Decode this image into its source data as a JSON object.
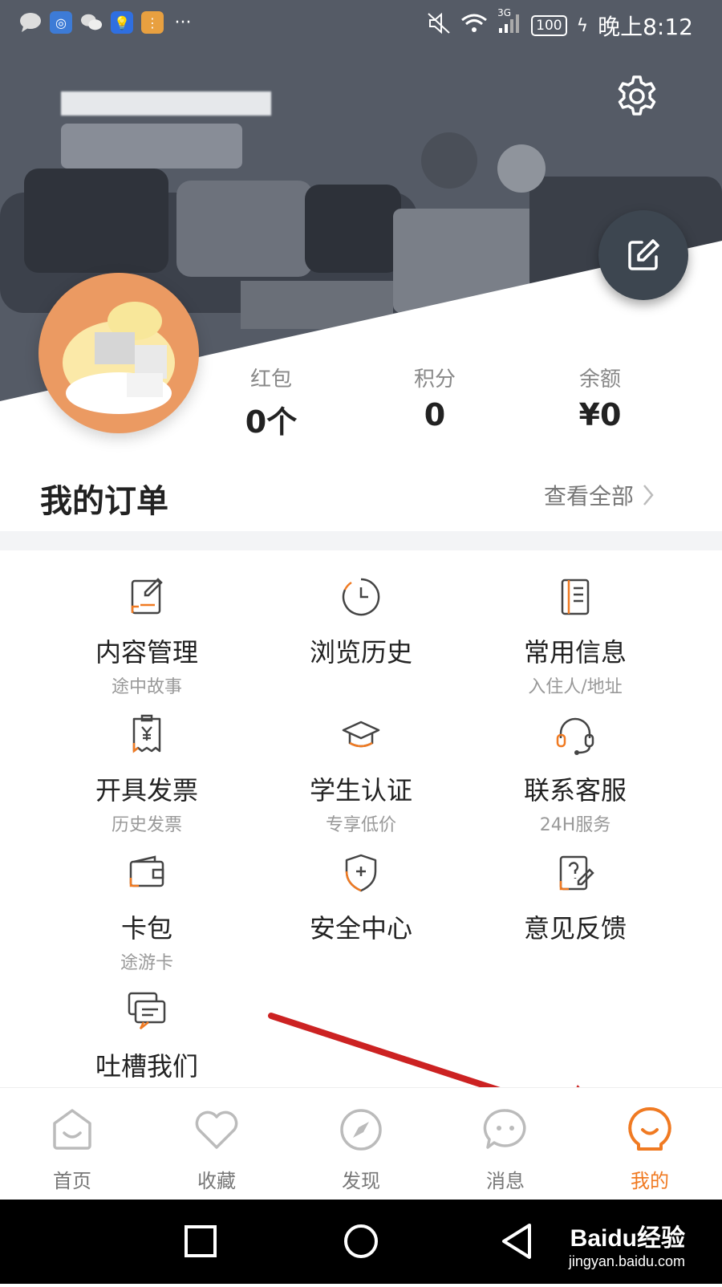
{
  "status_bar": {
    "time": "晚上8:12",
    "battery": "100",
    "network": "3G"
  },
  "profile": {
    "settings_icon": "gear-icon",
    "edit_icon": "edit-icon"
  },
  "stats": [
    {
      "label": "红包",
      "value": "0个"
    },
    {
      "label": "积分",
      "value": "0"
    },
    {
      "label": "余额",
      "value": "¥0"
    }
  ],
  "orders": {
    "title": "我的订单",
    "view_all": "查看全部"
  },
  "services": [
    {
      "title": "内容管理",
      "sub": "途中故事",
      "icon": "edit-document-icon"
    },
    {
      "title": "浏览历史",
      "sub": "",
      "icon": "clock-icon"
    },
    {
      "title": "常用信息",
      "sub": "入住人/地址",
      "icon": "notebook-icon"
    },
    {
      "title": "开具发票",
      "sub": "历史发票",
      "icon": "invoice-icon"
    },
    {
      "title": "学生认证",
      "sub": "专享低价",
      "icon": "graduation-cap-icon"
    },
    {
      "title": "联系客服",
      "sub": "24H服务",
      "icon": "headset-icon"
    },
    {
      "title": "卡包",
      "sub": "途游卡",
      "icon": "wallet-icon"
    },
    {
      "title": "安全中心",
      "sub": "",
      "icon": "shield-icon"
    },
    {
      "title": "意见反馈",
      "sub": "",
      "icon": "feedback-icon"
    },
    {
      "title": "吐槽我们",
      "sub": "",
      "icon": "chat-icon"
    }
  ],
  "bottom_nav": [
    {
      "label": "首页",
      "icon": "home-icon"
    },
    {
      "label": "收藏",
      "icon": "heart-icon"
    },
    {
      "label": "发现",
      "icon": "compass-icon"
    },
    {
      "label": "消息",
      "icon": "message-icon"
    },
    {
      "label": "我的",
      "icon": "profile-icon",
      "active": true
    }
  ],
  "watermark": {
    "brand": "Baidu经验",
    "url": "jingyan.baidu.com"
  },
  "colors": {
    "accent": "#f07a22",
    "header_dark": "#4f5561",
    "avatar_bg": "#eb9a62",
    "arrow_red": "#cc2222"
  }
}
